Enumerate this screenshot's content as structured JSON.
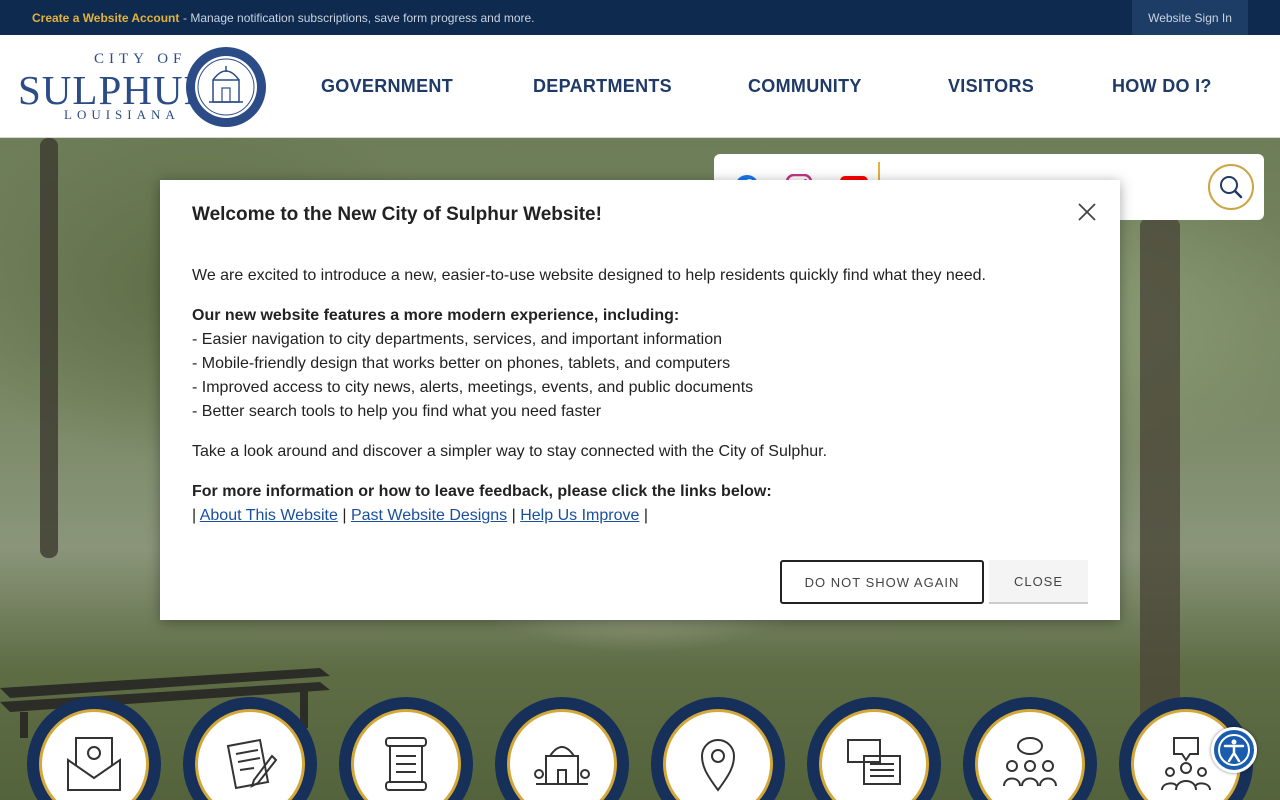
{
  "topbar": {
    "create_account": "Create a Website Account",
    "description": "- Manage notification subscriptions, save form progress and more.",
    "sign_in": "Website Sign In"
  },
  "logo": {
    "city_of": "CITY OF",
    "name": "SULPHUR",
    "state": "LOUISIANA"
  },
  "nav": [
    "GOVERNMENT",
    "DEPARTMENTS",
    "COMMUNITY",
    "VISITORS",
    "HOW DO I?"
  ],
  "social": {
    "icons": [
      "facebook-icon",
      "instagram-icon",
      "youtube-icon"
    ],
    "colors": {
      "facebook": "#1877f2",
      "instagram": "#c13584",
      "youtube": "#ff0000"
    }
  },
  "search": {
    "placeholder": ""
  },
  "modal": {
    "title": "Welcome to the New City of Sulphur Website!",
    "intro": "We are excited to introduce a new, easier-to-use website designed to help residents quickly find what they need.",
    "features_heading": "Our new website features a more modern experience, including:",
    "features": [
      "- Easier navigation to city departments, services, and important information",
      "- Mobile-friendly design that works better on phones, tablets, and computers",
      "- Improved access to city news, alerts, meetings, events, and public documents",
      "- Better search tools to help you find what you need faster"
    ],
    "closing": "Take a look around and discover a simpler way to stay connected with the City of Sulphur.",
    "feedback_heading": "For more information or how to leave feedback, please click the links below:",
    "separator": "|",
    "links": [
      "About This Website",
      "Past Website Designs",
      "Help Us Improve"
    ],
    "btn_do_not_show": "DO NOT SHOW AGAIN",
    "btn_close": "CLOSE"
  },
  "quick_links": {
    "icons": [
      "notify-me-icon",
      "forms-icon",
      "documents-icon",
      "city-hall-icon",
      "map-location-icon",
      "news-icon",
      "meetings-icon",
      "feedback-icon"
    ]
  },
  "colors": {
    "navy": "#0e2b4f",
    "gold": "#d4a838",
    "link": "#1a4fa0",
    "nav_text": "#1f3a66"
  }
}
